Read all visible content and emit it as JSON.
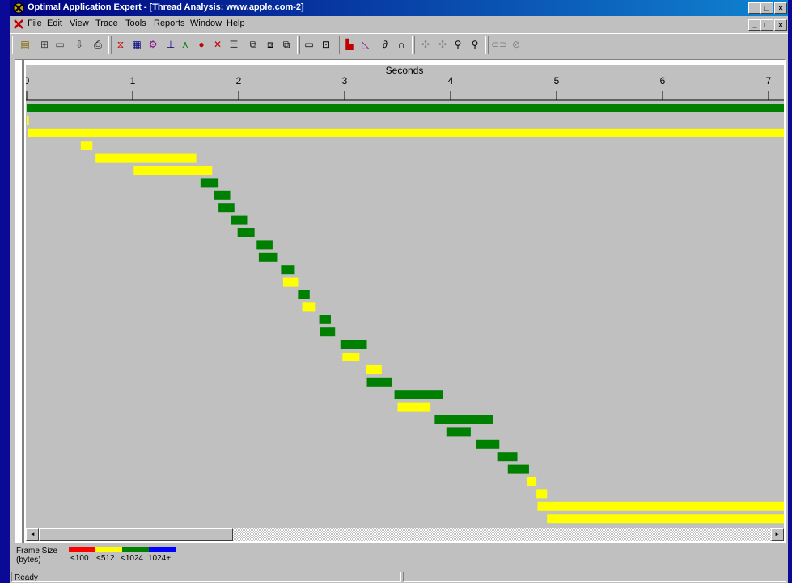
{
  "window": {
    "title": "Optimal Application Expert - [Thread Analysis: www.apple.com-2]",
    "controls": [
      "_",
      "□",
      "×"
    ]
  },
  "menu": {
    "items": [
      "File",
      "Edit",
      "View",
      "Trace",
      "Tools",
      "Reports",
      "Window",
      "Help"
    ]
  },
  "toolbar": {
    "icons": [
      "open-icon",
      "save-icon",
      "close-file-icon",
      "import-icon",
      "print-icon",
      "filter-icon",
      "table-icon",
      "gear-icon",
      "network-icon",
      "graph-icon",
      "pie-icon",
      "cut-icon",
      "list-icon",
      "copy-icon",
      "paste-icon",
      "copy2-icon",
      "window-icon",
      "capture-icon",
      "bar-chart-icon",
      "line-chart-icon",
      "link-icon",
      "arc-icon",
      "expand-icon",
      "collapse-icon",
      "zoom-in-icon",
      "zoom-out-icon",
      "chain-icon",
      "unchain-icon"
    ]
  },
  "chart_data": {
    "type": "timeline",
    "xlabel": "Seconds",
    "xlim": [
      0,
      7.15
    ],
    "ticks": [
      "0",
      "1",
      "2",
      "3",
      "4",
      "5",
      "6",
      "7"
    ],
    "tick_values": [
      0,
      1,
      2,
      3,
      4,
      5,
      6,
      7
    ],
    "colors": {
      "<100": "#ff0000",
      "<512": "#ffff00",
      "<1024": "#008000",
      "1024+": "#0000ff"
    },
    "bars": [
      {
        "start": 0.0,
        "end": 7.15,
        "category": "<1024"
      },
      {
        "start": 0.0,
        "end": 0.02,
        "category": "<512"
      },
      {
        "start": 0.01,
        "end": 7.15,
        "category": "<512"
      },
      {
        "start": 0.51,
        "end": 0.62,
        "category": "<512"
      },
      {
        "start": 0.65,
        "end": 1.6,
        "category": "<512"
      },
      {
        "start": 1.01,
        "end": 1.75,
        "category": "<512"
      },
      {
        "start": 1.64,
        "end": 1.81,
        "category": "<1024"
      },
      {
        "start": 1.77,
        "end": 1.92,
        "category": "<1024"
      },
      {
        "start": 1.81,
        "end": 1.96,
        "category": "<1024"
      },
      {
        "start": 1.93,
        "end": 2.08,
        "category": "<1024"
      },
      {
        "start": 1.99,
        "end": 2.15,
        "category": "<1024"
      },
      {
        "start": 2.17,
        "end": 2.32,
        "category": "<1024"
      },
      {
        "start": 2.19,
        "end": 2.37,
        "category": "<1024"
      },
      {
        "start": 2.4,
        "end": 2.53,
        "category": "<1024"
      },
      {
        "start": 2.42,
        "end": 2.56,
        "category": "<512"
      },
      {
        "start": 2.56,
        "end": 2.67,
        "category": "<1024"
      },
      {
        "start": 2.6,
        "end": 2.72,
        "category": "<512"
      },
      {
        "start": 2.76,
        "end": 2.87,
        "category": "<1024"
      },
      {
        "start": 2.77,
        "end": 2.91,
        "category": "<1024"
      },
      {
        "start": 2.96,
        "end": 3.21,
        "category": "<1024"
      },
      {
        "start": 2.98,
        "end": 3.14,
        "category": "<512"
      },
      {
        "start": 3.2,
        "end": 3.35,
        "category": "<512"
      },
      {
        "start": 3.21,
        "end": 3.45,
        "category": "<1024"
      },
      {
        "start": 3.47,
        "end": 3.93,
        "category": "<1024"
      },
      {
        "start": 3.5,
        "end": 3.81,
        "category": "<512"
      },
      {
        "start": 3.85,
        "end": 4.4,
        "category": "<1024"
      },
      {
        "start": 3.96,
        "end": 4.19,
        "category": "<1024"
      },
      {
        "start": 4.24,
        "end": 4.46,
        "category": "<1024"
      },
      {
        "start": 4.44,
        "end": 4.63,
        "category": "<1024"
      },
      {
        "start": 4.54,
        "end": 4.74,
        "category": "<1024"
      },
      {
        "start": 4.72,
        "end": 4.81,
        "category": "<512"
      },
      {
        "start": 4.81,
        "end": 4.91,
        "category": "<512"
      },
      {
        "start": 4.82,
        "end": 7.15,
        "category": "<512"
      },
      {
        "start": 4.91,
        "end": 7.15,
        "category": "<512"
      }
    ]
  },
  "legend": {
    "label": "Frame Size\n(bytes)",
    "items": [
      {
        "label": "<100",
        "color": "#ff0000"
      },
      {
        "label": "<512",
        "color": "#ffff00"
      },
      {
        "label": "<1024",
        "color": "#008000"
      },
      {
        "label": "1024+",
        "color": "#0000ff"
      }
    ]
  },
  "scrollbar": {
    "left_arrow": "◄",
    "right_arrow": "►"
  },
  "status": {
    "text": "Ready"
  }
}
